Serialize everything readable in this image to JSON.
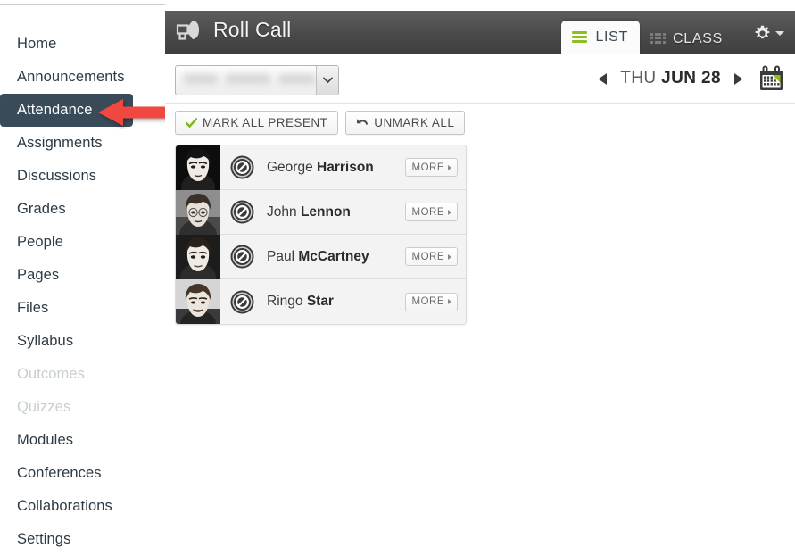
{
  "sidebar": {
    "items": [
      {
        "label": "Home",
        "state": "normal"
      },
      {
        "label": "Announcements",
        "state": "normal"
      },
      {
        "label": "Attendance",
        "state": "active"
      },
      {
        "label": "Assignments",
        "state": "normal"
      },
      {
        "label": "Discussions",
        "state": "normal"
      },
      {
        "label": "Grades",
        "state": "normal"
      },
      {
        "label": "People",
        "state": "normal"
      },
      {
        "label": "Pages",
        "state": "normal"
      },
      {
        "label": "Files",
        "state": "normal"
      },
      {
        "label": "Syllabus",
        "state": "normal"
      },
      {
        "label": "Outcomes",
        "state": "disabled"
      },
      {
        "label": "Quizzes",
        "state": "disabled"
      },
      {
        "label": "Modules",
        "state": "normal"
      },
      {
        "label": "Conferences",
        "state": "normal"
      },
      {
        "label": "Collaborations",
        "state": "normal"
      },
      {
        "label": "Settings",
        "state": "normal"
      }
    ],
    "active_background": "#394b58",
    "disabled_color": "#c7cdd1"
  },
  "annotation": {
    "arrow_color": "#f04641",
    "points_at": "Attendance"
  },
  "header": {
    "title": "Roll Call",
    "megaphone_icon": "megaphone-icon",
    "gear_icon": "gear-icon",
    "background": "#4a4a4a",
    "tabs": [
      {
        "label": "LIST",
        "icon": "list-lines-icon",
        "active": true
      },
      {
        "label": "CLASS",
        "icon": "grid-icon",
        "active": false
      }
    ]
  },
  "toolbar": {
    "section_select": {
      "value": "",
      "placeholder": "",
      "redacted": true,
      "chevron_icon": "chevron-down-icon"
    },
    "date_nav": {
      "prev_icon": "triangle-left-icon",
      "next_icon": "triangle-right-icon",
      "weekday": "THU",
      "monthday": "JUN 28",
      "calendar_icon": "calendar-icon",
      "calendar_accent": "#8fbf1f"
    }
  },
  "bulk_actions": [
    {
      "label": "MARK ALL PRESENT",
      "icon": "check-icon",
      "icon_color": "#7fb819"
    },
    {
      "label": "UNMARK ALL",
      "icon": "undo-arrow-icon",
      "icon_color": "#4c4c4c"
    }
  ],
  "roster": {
    "more_label": "MORE",
    "status_icon": "unmarked-circle-slash-icon",
    "students": [
      {
        "first": "George",
        "last": "Harrison",
        "status": "unmarked"
      },
      {
        "first": "John",
        "last": "Lennon",
        "status": "unmarked"
      },
      {
        "first": "Paul",
        "last": "McCartney",
        "status": "unmarked"
      },
      {
        "first": "Ringo",
        "last": "Star",
        "status": "unmarked"
      }
    ]
  }
}
